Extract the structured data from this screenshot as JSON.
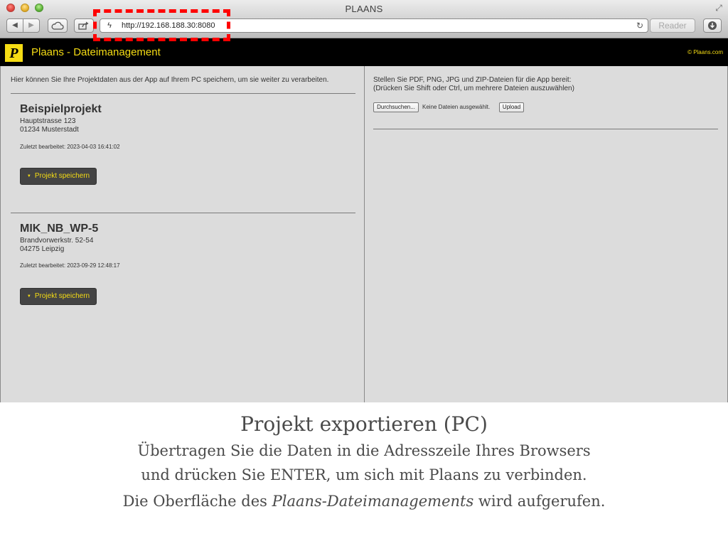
{
  "window": {
    "title": "PLAANS"
  },
  "toolbar": {
    "url": "http://192.168.188.30:8080",
    "reader_label": "Reader"
  },
  "app": {
    "logo_letter": "P",
    "title": "Plaans - Dateimanagement",
    "copyright": "© Plaans.com"
  },
  "left": {
    "intro": "Hier können Sie Ihre Projektdaten aus der App auf Ihrem PC speichern, um sie weiter zu verarbeiten.",
    "projects": [
      {
        "name": "Beispielprojekt",
        "street": "Hauptstrasse 123",
        "city": "01234 Musterstadt",
        "last_edited": "Zuletzt bearbeitet: 2023-04-03 16:41:02",
        "button_label": "Projekt speichern"
      },
      {
        "name": "MIK_NB_WP-5",
        "street": "Brandvorwerkstr. 52-54",
        "city": "04275 Leipzig",
        "last_edited": "Zuletzt bearbeitet: 2023-09-29 12:48:17",
        "button_label": "Projekt speichern"
      }
    ]
  },
  "right": {
    "line1": "Stellen Sie PDF, PNG, JPG und ZIP-Dateien für die App bereit:",
    "line2": "(Drücken Sie Shift oder Ctrl, um mehrere Dateien auszuwählen)",
    "browse_label": "Durchsuchen...",
    "no_files": "Keine Dateien ausgewählt.",
    "upload_label": "Upload"
  },
  "caption": {
    "title": "Projekt exportieren (PC)",
    "line1": "Übertragen Sie die Daten in die Adresszeile Ihres Browsers",
    "line2": "und drücken Sie ENTER, um sich mit Plaans zu verbinden.",
    "line3_prefix": "Die Oberfläche des ",
    "line3_italic": "Plaans-Dateimanagements",
    "line3_suffix": " wird aufgerufen."
  },
  "colors": {
    "accent_yellow": "#f5dc14",
    "header_black": "#000000",
    "panel_gray": "#dcdcdc",
    "button_dark": "#444444",
    "highlight_red": "#ff0000"
  },
  "icons": [
    "back-icon",
    "forward-icon",
    "cloud-icon",
    "share-icon",
    "lightning-favicon-icon",
    "reload-icon",
    "download-icon",
    "resize-icon",
    "triangle-down-icon"
  ]
}
